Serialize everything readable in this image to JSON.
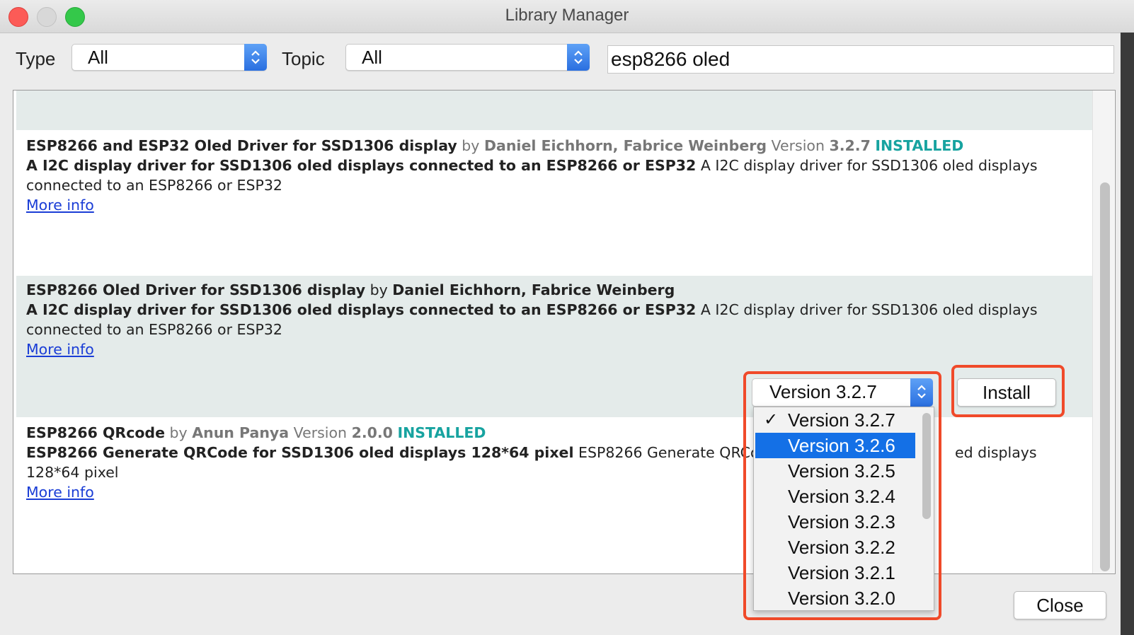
{
  "window": {
    "title": "Library Manager"
  },
  "filters": {
    "type_label": "Type",
    "type_value": "All",
    "topic_label": "Topic",
    "topic_value": "All",
    "search_value": "esp8266 oled"
  },
  "libraries": [
    {
      "name": "ESP8266 and ESP32 Oled Driver for SSD1306 display",
      "by": "by",
      "author": "Daniel Eichhorn, Fabrice Weinberg",
      "version_label": "Version",
      "version": "3.2.7",
      "status": "INSTALLED",
      "sentence_bold": "A I2C display driver for SSD1306 oled displays connected to an ESP8266 or ESP32",
      "sentence_rest": "A I2C display driver for SSD1306 oled displays",
      "sentence_cont": "connected to an ESP8266 or ESP32",
      "more_info": "More info"
    },
    {
      "name": "ESP8266 Oled Driver for SSD1306 display",
      "by": "by",
      "author": "Daniel Eichhorn, Fabrice Weinberg",
      "sentence_bold": "A I2C display driver for SSD1306 oled displays connected to an ESP8266 or ESP32",
      "sentence_rest": "A I2C display driver for SSD1306 oled displays",
      "sentence_cont": "connected to an ESP8266 or ESP32",
      "more_info": "More info"
    },
    {
      "name": "ESP8266 QRcode",
      "by": "by",
      "author": "Anun Panya",
      "version_label": "Version",
      "version": "2.0.0",
      "status": "INSTALLED",
      "sentence_bold": "ESP8266 Generate QRCode for SSD1306 oled displays 128*64 pixel",
      "sentence_rest": "ESP8266 Generate QRCode",
      "sentence_tail": "ed displays",
      "sentence_cont": "128*64 pixel",
      "more_info": "More info"
    }
  ],
  "version_select": {
    "selected": "Version 3.2.7",
    "options": [
      {
        "label": "Version 3.2.7",
        "checked": "✓"
      },
      {
        "label": "Version 3.2.6"
      },
      {
        "label": "Version 3.2.5"
      },
      {
        "label": "Version 3.2.4"
      },
      {
        "label": "Version 3.2.3"
      },
      {
        "label": "Version 3.2.2"
      },
      {
        "label": "Version 3.2.1"
      },
      {
        "label": "Version 3.2.0"
      }
    ],
    "highlighted_option": "Version 3.2.6"
  },
  "buttons": {
    "install": "Install",
    "close": "Close"
  },
  "colors": {
    "accent": "#2a6fe0",
    "selection": "#1470e6",
    "installed": "#17a3a0",
    "highlight_frame": "#f04a2a",
    "link": "#1a3dd6"
  }
}
